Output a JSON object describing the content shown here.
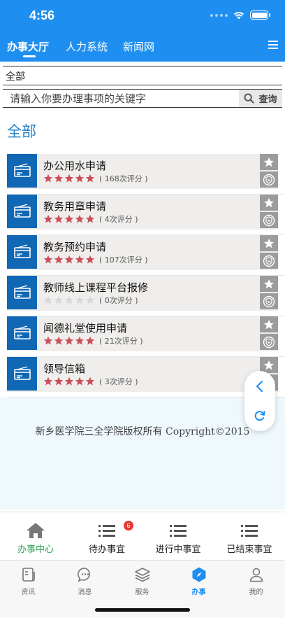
{
  "status": {
    "time": "4:56"
  },
  "topnav": {
    "tabs": [
      {
        "label": "办事大厅",
        "active": true
      },
      {
        "label": "人力系统",
        "active": false
      },
      {
        "label": "新闻网",
        "active": false
      }
    ]
  },
  "category_select": {
    "value": "全部"
  },
  "search": {
    "placeholder": "请输入你要办理事项的关键字",
    "button_label": "查询"
  },
  "section_title": "全部",
  "services": [
    {
      "name": "办公用水申请",
      "rating_text": "( 168次评分 )",
      "stars_filled": 5
    },
    {
      "name": "教务用章申请",
      "rating_text": "( 4次评分 )",
      "stars_filled": 5
    },
    {
      "name": "教务预约申请",
      "rating_text": "( 107次评分 )",
      "stars_filled": 5
    },
    {
      "name": "教师线上课程平台报修",
      "rating_text": "( 0次评分 )",
      "stars_filled": 0
    },
    {
      "name": "闻德礼堂使用申请",
      "rating_text": "( 21次评分 )",
      "stars_filled": 5
    },
    {
      "name": "领导信箱",
      "rating_text": "( 3次评分 )",
      "stars_filled": 5
    }
  ],
  "footer": {
    "copyright": "新乡医学院三全学院版权所有 Copyright©2015"
  },
  "subtabs": [
    {
      "label": "办事中心",
      "active": true
    },
    {
      "label": "待办事宜",
      "active": false,
      "badge": "6"
    },
    {
      "label": "进行中事宜",
      "active": false
    },
    {
      "label": "已结束事宜",
      "active": false
    }
  ],
  "bottom_tabs": [
    {
      "label": "资讯",
      "icon": "news-icon",
      "active": false
    },
    {
      "label": "消息",
      "icon": "message-icon",
      "active": false
    },
    {
      "label": "服务",
      "icon": "layers-icon",
      "active": false
    },
    {
      "label": "办事",
      "icon": "compass-icon",
      "active": true
    },
    {
      "label": "我的",
      "icon": "person-icon",
      "active": false
    }
  ],
  "colors": {
    "primary": "#1e8ff0",
    "item_icon_bg": "#1068b4",
    "star_filled": "#c9505a",
    "star_empty": "#d8d8d8",
    "active_green": "#31a35a",
    "badge_red": "#e53935"
  }
}
